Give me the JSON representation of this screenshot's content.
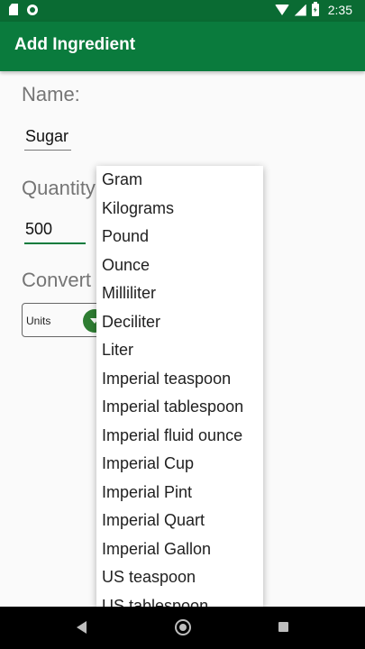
{
  "status_bar": {
    "time": "2:35",
    "icons": [
      "sd-card-icon",
      "sync-icon",
      "wifi-icon",
      "signal-icon",
      "battery-charging-icon"
    ]
  },
  "app_bar": {
    "title": "Add Ingredient"
  },
  "form": {
    "name_label": "Name:",
    "name_value": "Sugar",
    "quantity_label": "Quantity",
    "quantity_value": "500",
    "convert_label": "Convert",
    "units_selected": "Units"
  },
  "units_popup": {
    "items": [
      "Gram",
      "Kilograms",
      "Pound",
      "Ounce",
      "Milliliter",
      "Deciliter",
      "Liter",
      "Imperial teaspoon",
      "Imperial tablespoon",
      "Imperial fluid ounce",
      "Imperial Cup",
      "Imperial Pint",
      "Imperial Quart",
      "Imperial Gallon",
      "US teaspoon",
      "US tablespoon"
    ]
  },
  "nav_bar": {
    "icons": [
      "back-icon",
      "home-icon",
      "recents-icon"
    ]
  },
  "colors": {
    "status_bar": "#0a6b33",
    "app_bar": "#0a7b3d",
    "accent": "#2e7d32"
  }
}
